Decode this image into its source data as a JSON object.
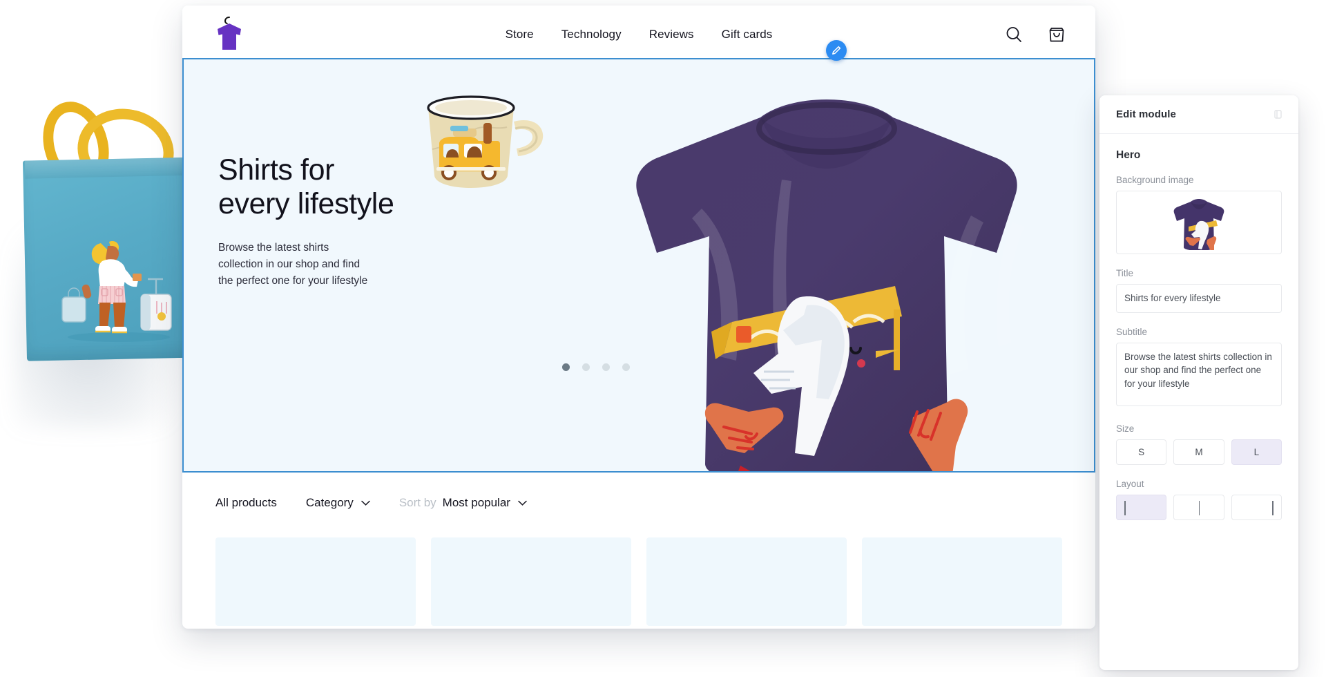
{
  "site": {
    "logo_icon": "tshirt-hanger-logo",
    "nav": [
      {
        "label": "Store"
      },
      {
        "label": "Technology"
      },
      {
        "label": "Reviews"
      },
      {
        "label": "Gift cards"
      }
    ],
    "icons": {
      "search": "search-icon",
      "cart": "shopping-bag-icon"
    }
  },
  "hero": {
    "title": "Shirts for\never­y lifestyle",
    "title_plain": "Shirts for\nevery lifestyle",
    "subtitle": "Browse the latest shirts\ncollection in our shop and find\nthe perfect one for your lifestyle",
    "carousel": {
      "total": 4,
      "active_index": 0
    },
    "edit_badge_icon": "pencil-icon",
    "selection_color": "#3c8ed0",
    "background_color": "#f1f8fd"
  },
  "filters": {
    "all_products": "All products",
    "category": "Category",
    "sort_by_label": "Sort by",
    "sort_value": "Most popular",
    "chevron_icon": "chevron-down-icon"
  },
  "product_grid": {
    "placeholder_count": 4,
    "placeholder_color": "#eff8fd"
  },
  "panel": {
    "title": "Edit module",
    "collapse_icon": "collapse-icon",
    "module": "Hero",
    "background_image": {
      "label": "Background image",
      "thumb_alt": "purple-tshirt-thumbnail"
    },
    "title_field": {
      "label": "Title",
      "value": "Shirts for every lifestyle"
    },
    "subtitle_field": {
      "label": "Subtitle",
      "value": "Browse the latest shirts collection in our shop and find the perfect one for your lifestyle"
    },
    "size": {
      "label": "Size",
      "options": [
        "S",
        "M",
        "L"
      ],
      "selected": "L"
    },
    "layout": {
      "label": "Layout",
      "options": [
        "align-left",
        "align-center",
        "align-right"
      ],
      "selected": "align-left"
    },
    "accent_selected": "#eceaf7"
  },
  "decor": {
    "tote_label": "teal-tote-bag-photo",
    "mug_label": "enamel-mug-photo",
    "shirt_label": "purple-tshirt-photo"
  }
}
